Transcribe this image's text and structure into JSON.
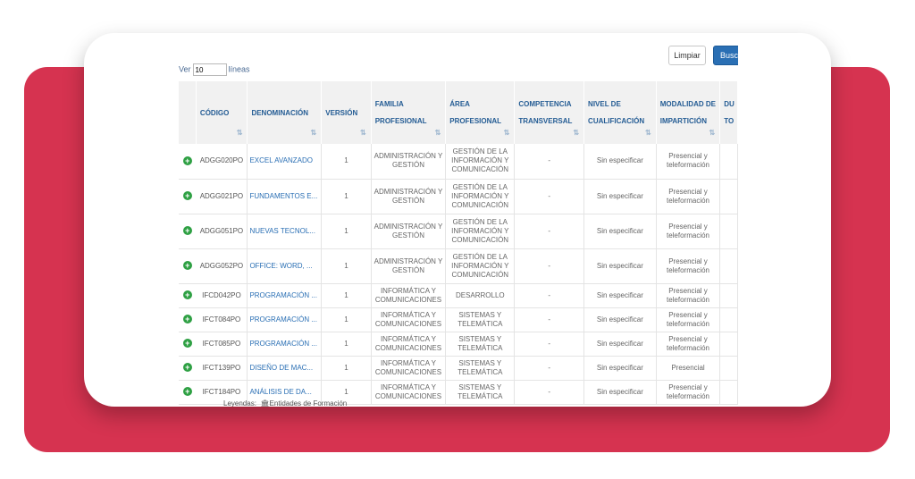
{
  "toolbar": {
    "limpiar_label": "Limpiar",
    "buscar_label": "Buscar"
  },
  "page_size": {
    "prefix": "Ver",
    "value": "10",
    "suffix": "líneas"
  },
  "table": {
    "headers": [
      "CÓDIGO",
      "DENOMINACIÓN",
      "VERSIÓN",
      "FAMILIA PROFESIONAL",
      "ÁREA PROFESIONAL",
      "COMPETENCIA TRANSVERSAL",
      "NIVEL DE CUALIFICACIÓN",
      "MODALIDAD DE IMPARTICIÓN",
      "DU TO"
    ],
    "rows": [
      {
        "codigo": "ADGG020PO",
        "denominacion": "EXCEL AVANZADO",
        "version": "1",
        "familia": "ADMINISTRACIÓN Y GESTIÓN",
        "area": "GESTIÓN DE LA INFORMACIÓN Y COMUNICACIÓN",
        "competencia": "-",
        "nivel": "Sin especificar",
        "modalidad": "Presencial y teleformación"
      },
      {
        "codigo": "ADGG021PO",
        "denominacion": "FUNDAMENTOS E...",
        "version": "1",
        "familia": "ADMINISTRACIÓN Y GESTIÓN",
        "area": "GESTIÓN DE LA INFORMACIÓN Y COMUNICACIÓN",
        "competencia": "-",
        "nivel": "Sin especificar",
        "modalidad": "Presencial y teleformación"
      },
      {
        "codigo": "ADGG051PO",
        "denominacion": "NUEVAS TECNOL...",
        "version": "1",
        "familia": "ADMINISTRACIÓN Y GESTIÓN",
        "area": "GESTIÓN DE LA INFORMACIÓN Y COMUNICACIÓN",
        "competencia": "-",
        "nivel": "Sin especificar",
        "modalidad": "Presencial y teleformación"
      },
      {
        "codigo": "ADGG052PO",
        "denominacion": "OFFICE: WORD, ...",
        "version": "1",
        "familia": "ADMINISTRACIÓN Y GESTIÓN",
        "area": "GESTIÓN DE LA INFORMACIÓN Y COMUNICACIÓN",
        "competencia": "-",
        "nivel": "Sin especificar",
        "modalidad": "Presencial y teleformación"
      },
      {
        "codigo": "IFCD042PO",
        "denominacion": "PROGRAMACIÓN ...",
        "version": "1",
        "familia": "INFORMÁTICA Y COMUNICACIONES",
        "area": "DESARROLLO",
        "competencia": "-",
        "nivel": "Sin especificar",
        "modalidad": "Presencial y teleformación"
      },
      {
        "codigo": "IFCT084PO",
        "denominacion": "PROGRAMACIÓN ...",
        "version": "1",
        "familia": "INFORMÁTICA Y COMUNICACIONES",
        "area": "SISTEMAS Y TELEMÁTICA",
        "competencia": "-",
        "nivel": "Sin especificar",
        "modalidad": "Presencial y teleformación"
      },
      {
        "codigo": "IFCT085PO",
        "denominacion": "PROGRAMACIÓN ...",
        "version": "1",
        "familia": "INFORMÁTICA Y COMUNICACIONES",
        "area": "SISTEMAS Y TELEMÁTICA",
        "competencia": "-",
        "nivel": "Sin especificar",
        "modalidad": "Presencial y teleformación"
      },
      {
        "codigo": "IFCT139PO",
        "denominacion": "DISEÑO DE MAC...",
        "version": "1",
        "familia": "INFORMÁTICA Y COMUNICACIONES",
        "area": "SISTEMAS Y TELEMÁTICA",
        "competencia": "-",
        "nivel": "Sin especificar",
        "modalidad": "Presencial"
      },
      {
        "codigo": "IFCT184PO",
        "denominacion": "ANÁLISIS DE DA...",
        "version": "1",
        "familia": "INFORMÁTICA Y COMUNICACIONES",
        "area": "SISTEMAS Y TELEMÁTICA",
        "competencia": "-",
        "nivel": "Sin especificar",
        "modalidad": "Presencial y teleformación"
      }
    ]
  },
  "legend": {
    "label": "Leyendas:",
    "item": "Entidades de Formación"
  },
  "colors": {
    "accent": "#2a6fb4",
    "background_band": "#d63350",
    "expand_icon": "#2ea043"
  }
}
